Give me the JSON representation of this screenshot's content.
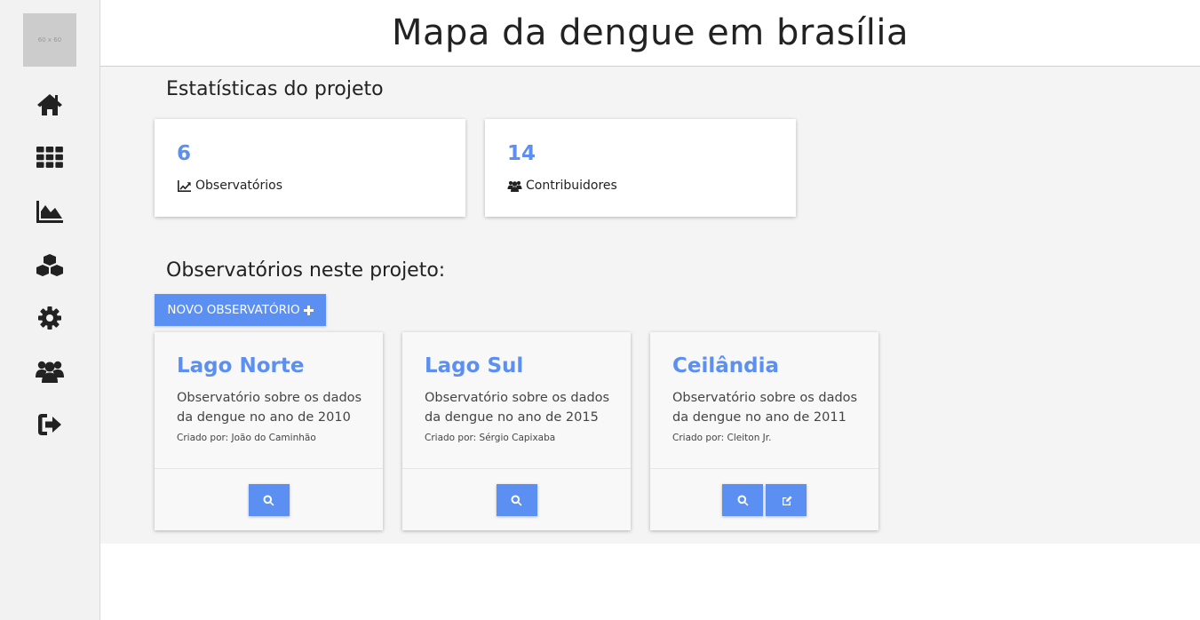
{
  "sidebar": {
    "logo_text": "60 x 60",
    "items": [
      {
        "icon": "home-icon"
      },
      {
        "icon": "grid-icon"
      },
      {
        "icon": "area-chart-icon"
      },
      {
        "icon": "cubes-icon"
      },
      {
        "icon": "gear-icon"
      },
      {
        "icon": "users-icon"
      },
      {
        "icon": "sign-out-icon"
      }
    ]
  },
  "header": {
    "title": "Mapa da dengue em brasília"
  },
  "stats": {
    "title": "Estatísticas do projeto",
    "observatories": {
      "value": "6",
      "label": "Observatórios",
      "icon": "line-chart-icon"
    },
    "contributors": {
      "value": "14",
      "label": "Contribuidores",
      "icon": "users-icon"
    }
  },
  "observatories": {
    "title": "Observatórios neste projeto:",
    "new_button_label": "NOVO OBSERVATÓRIO",
    "cards": [
      {
        "name": "Lago Norte",
        "description": "Observatório sobre os dados da dengue no ano de 2010",
        "author": "Criado por: João do Caminhão",
        "actions": [
          "search-icon"
        ]
      },
      {
        "name": "Lago Sul",
        "description": "Observatório sobre os dados da dengue no ano de 2015",
        "author": "Criado por: Sérgio Capixaba",
        "actions": [
          "search-icon"
        ]
      },
      {
        "name": "Ceilândia",
        "description": "Observatório sobre os dados da dengue no ano de 2011",
        "author": "Criado por: Cleiton Jr.",
        "actions": [
          "search-icon",
          "edit-icon"
        ]
      }
    ]
  },
  "colors": {
    "accent": "#5b8ff2",
    "sidebar_bg": "#f2f2f2",
    "content_bg": "#f4f4f4"
  }
}
